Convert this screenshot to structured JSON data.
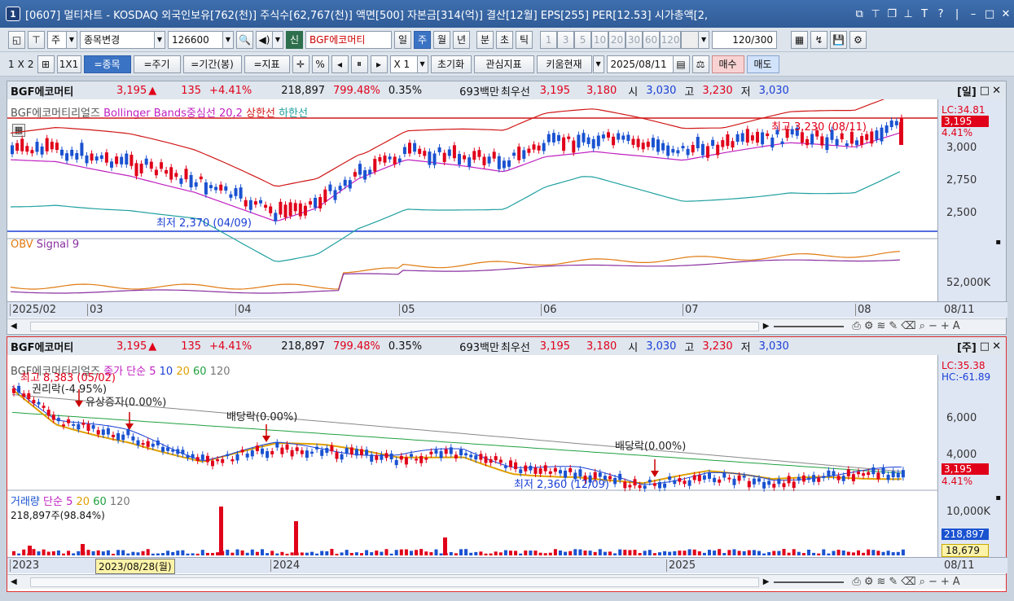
{
  "window": {
    "number": "1",
    "title": "[0607] 멀티차트 - KOSDAQ 외국인보유[762(천)] 주식수[62,767(천)] 액면[500] 자본금[314(억)] 결산[12월] EPS[255] PER[12.53] 시가총액[2,"
  },
  "toolbar1": {
    "market": "주",
    "change_label": "종목변경",
    "code": "126600",
    "new_badge": "신",
    "stock_name": "BGF에코머티",
    "periods": [
      "일",
      "주",
      "월",
      "년",
      "분",
      "초",
      "틱"
    ],
    "period_selected": "주",
    "nums": [
      "1",
      "3",
      "5",
      "10",
      "20",
      "30",
      "60",
      "120"
    ],
    "count": "120",
    "count_total": "/300"
  },
  "toolbar2": {
    "t1": "1",
    "tx": "X",
    "t2": "2",
    "one_by_one": "1X1",
    "stock_btn": "=종목",
    "period_btn": "=주기",
    "range_btn": "=기간(봉)",
    "indicator_btn": "=지표",
    "percent": "%",
    "zoom": "X 1",
    "reset": "초기화",
    "watch": "관심지표",
    "kiwoom": "키움현재",
    "date": "2025/08/11",
    "buy": "매수",
    "sell": "매도"
  },
  "top_panel": {
    "info": {
      "name": "BGF에코머티",
      "price": "3,195",
      "arrow": "▲",
      "change": "135",
      "pct": "+4.41%",
      "volume": "218,897",
      "vol_ratio": "799.48%",
      "turnover": "0.35%",
      "amount": "693백만",
      "best": "최우선",
      "ask": "3,195",
      "bid": "3,180",
      "open_label": "시",
      "open": "3,030",
      "high_label": "고",
      "high": "3,230",
      "low_label": "저",
      "low": "3,030",
      "period_tag": "[일]"
    },
    "legend": {
      "name": "BGF에코머티리얼즈",
      "bb": "Bollinger Bands중심선 20,2",
      "upper": "상한선",
      "lower": "하한선"
    },
    "annot": {
      "max": "최고 3,230 (08/11)",
      "min": "최저 2,370 (04/09)"
    },
    "scale": {
      "lc": "LC:34.81",
      "cur": "3,195",
      "pct": "4.41%",
      "ticks": [
        "3,000",
        "2,750",
        "2,500"
      ]
    },
    "obv": {
      "label": "OBV",
      "signal": "Signal 9",
      "tick": "52,000K"
    },
    "xaxis": {
      "labels": [
        "2025/02",
        "03",
        "04",
        "05",
        "06",
        "07",
        "08"
      ],
      "right": "08/11"
    }
  },
  "bottom_panel": {
    "info": {
      "name": "BGF에코머티",
      "price": "3,195",
      "arrow": "▲",
      "change": "135",
      "pct": "+4.41%",
      "volume": "218,897",
      "vol_ratio": "799.48%",
      "turnover": "0.35%",
      "amount": "693백만",
      "best": "최우선",
      "ask": "3,195",
      "bid": "3,180",
      "open_label": "시",
      "open": "3,030",
      "high_label": "고",
      "high": "3,230",
      "low_label": "저",
      "low": "3,030",
      "period_tag": "[주]"
    },
    "legend": {
      "name": "BGF에코머티리얼즈",
      "ma": "종가 단순 5",
      "m10": "10",
      "m20": "20",
      "m60": "60",
      "m120": "120"
    },
    "annot": {
      "max": "최고 8,383 (05/02)",
      "rights": "권리락(-4.95%)",
      "capital": "유상증자(0.00%)",
      "div1": "배당락(0.00%)",
      "div2": "배당락(0.00%)",
      "min": "최저 2,360 (12/09)"
    },
    "scale": {
      "lc": "LC:35.38",
      "hc": "HC:-61.89",
      "cur": "3,195",
      "pct": "4.41%",
      "ticks": [
        "6,000",
        "4,000"
      ]
    },
    "volume": {
      "label": "거래량",
      "ma": "단순 5",
      "m20": "20",
      "m60": "60",
      "m120": "120",
      "last": "218,897주(98.84%)",
      "tick": "10,000K",
      "cur": "218,897",
      "ma_val": "18,679"
    },
    "xaxis": {
      "labels": [
        "2023",
        "2024",
        "2025"
      ],
      "cursor": "2023/08/28(월)",
      "right": "08/11"
    }
  },
  "colors": {
    "up": "#e0001a",
    "down": "#1a52d0",
    "upper": "#d01818",
    "mid": "#c020c0",
    "lower": "#20a0a0"
  }
}
